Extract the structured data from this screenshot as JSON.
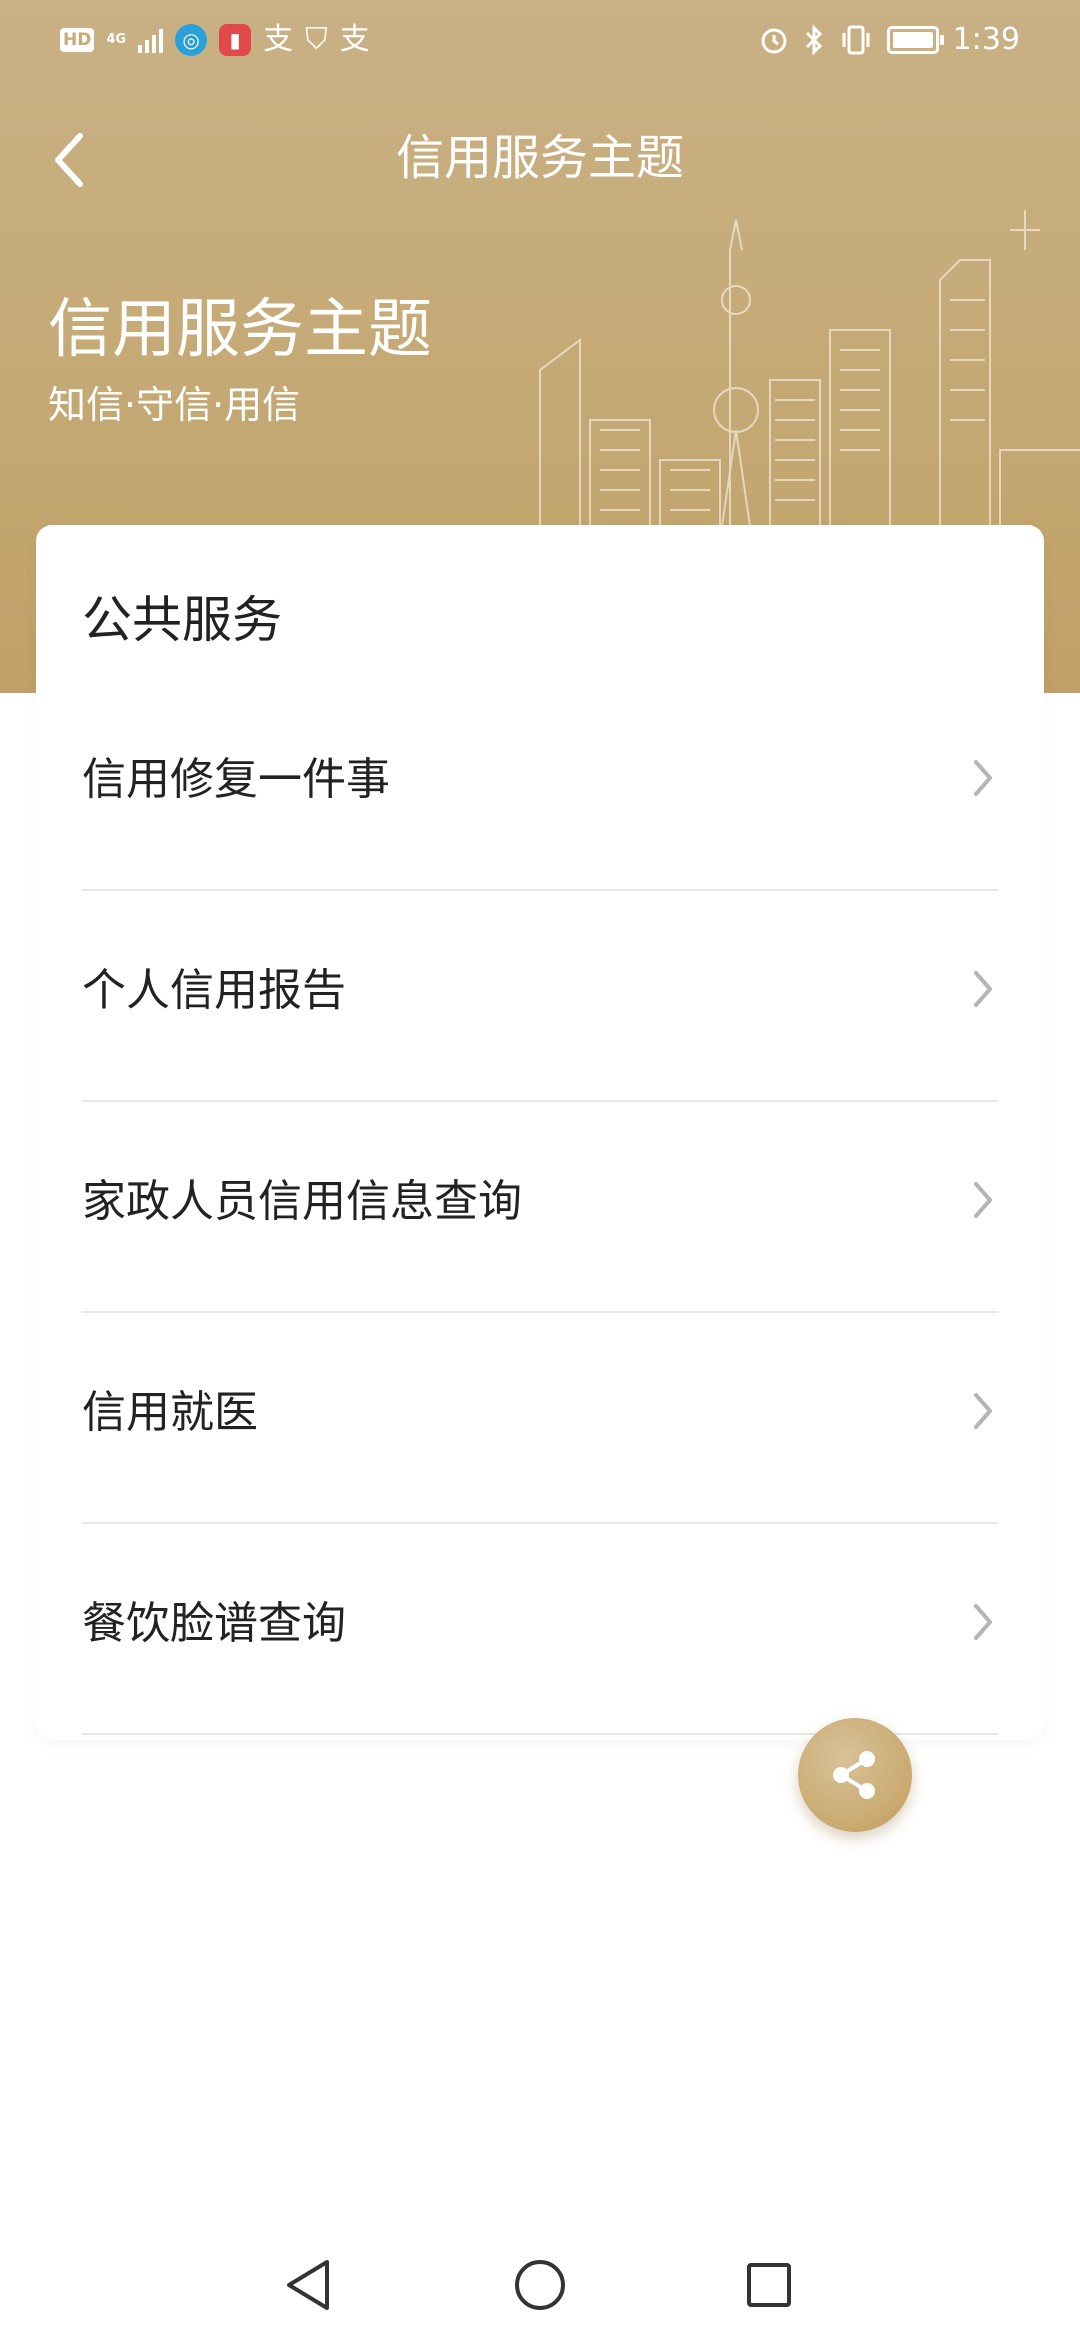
{
  "status_bar": {
    "hd_label": "HD",
    "network_label": "4G",
    "time": "1:39",
    "icons": [
      "signal-icon",
      "app-icon-blue",
      "app-icon-red",
      "alipay-icon",
      "shield-icon",
      "alipay-icon",
      "alarm-icon",
      "bluetooth-icon",
      "vibrate-icon",
      "battery-icon"
    ]
  },
  "nav": {
    "title": "信用服务主题",
    "back_icon": "chevron-left-icon"
  },
  "hero": {
    "title": "信用服务主题",
    "subtitle": "知信·守信·用信"
  },
  "card": {
    "section_title": "公共服务",
    "items": [
      {
        "label": "信用修复一件事"
      },
      {
        "label": "个人信用报告"
      },
      {
        "label": "家政人员信用信息查询"
      },
      {
        "label": "信用就医"
      },
      {
        "label": "餐饮脸谱查询"
      }
    ]
  },
  "share_button": {
    "icon": "share-icon"
  },
  "system_nav": {
    "icons": [
      "back-triangle-icon",
      "home-circle-icon",
      "recents-square-icon"
    ]
  },
  "colors": {
    "header_gold": "#c6ab78",
    "fab_gold": "#c9a96e",
    "text_dark": "#222222",
    "divider": "#e8e8e8"
  }
}
